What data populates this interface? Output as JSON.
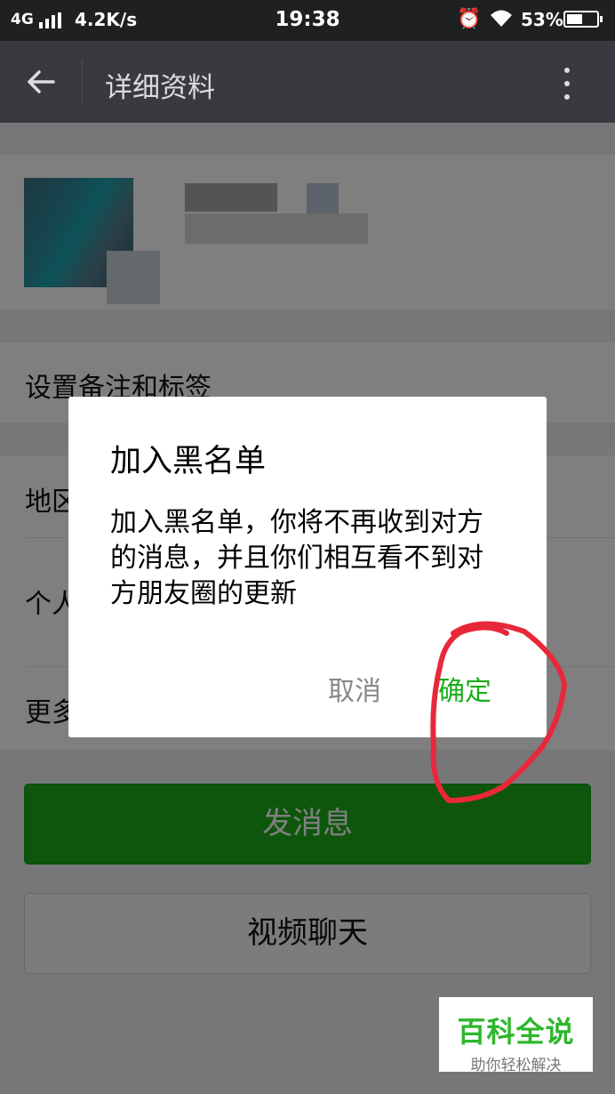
{
  "status_bar": {
    "network": "4G",
    "speed": "4.2K/s",
    "time": "19:38",
    "battery": "53%",
    "battery_level": 0.53
  },
  "header": {
    "title": "详细资料"
  },
  "profile": {
    "rows": [
      {
        "label": "设置备注和标签"
      },
      {
        "label": "地区"
      },
      {
        "label": "个人"
      },
      {
        "label": "更多"
      }
    ],
    "send_button": "发消息",
    "video_button": "视频聊天"
  },
  "dialog": {
    "title": "加入黑名单",
    "message": "加入黑名单，你将不再收到对方的消息，并且你们相互看不到对方朋友圈的更新",
    "cancel": "取消",
    "confirm": "确定"
  },
  "watermark": {
    "title": "百科全说",
    "subtitle": "助你轻松解决"
  },
  "colors": {
    "accent_green": "#1aad19",
    "annotation_red": "#e8283a"
  }
}
